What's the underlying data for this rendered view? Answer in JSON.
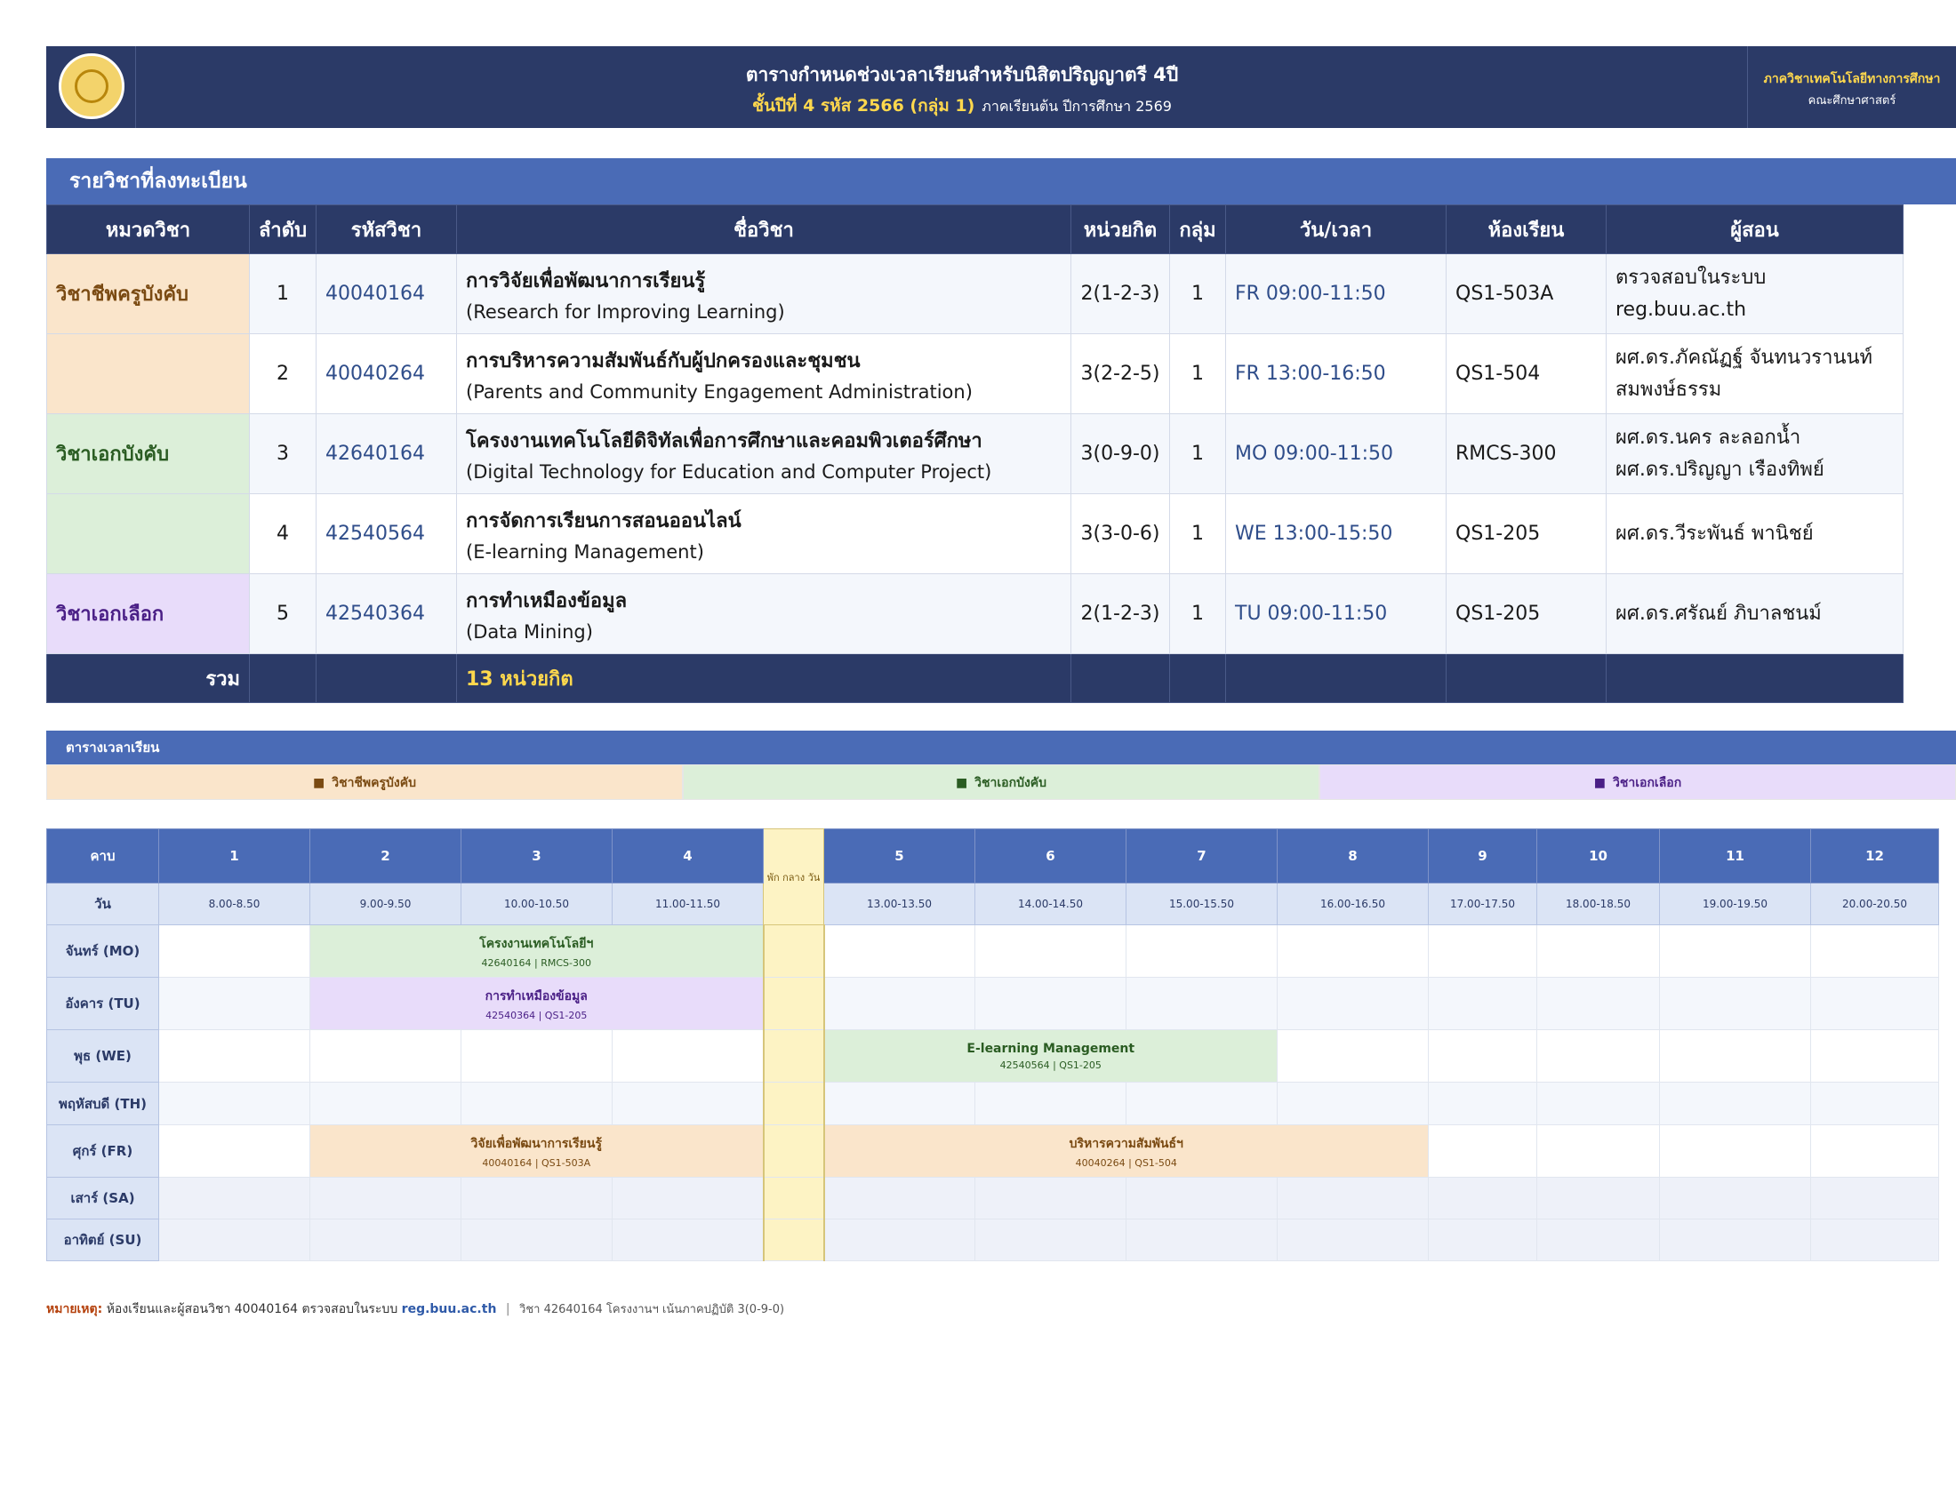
{
  "header": {
    "title": "ตารางกำหนดช่วงเวลาเรียนสำหรับนิสิตปริญญาตรี 4ปี",
    "subtitle": "ชั้นปีที่ 4  รหัส 2566  (กลุ่ม 1)",
    "term": "ภาคเรียนต้น ปีการศึกษา 2569",
    "department": "ภาควิชาเทคโนโลยีทางการศึกษา",
    "faculty": "คณะศึกษาศาสตร์"
  },
  "courses": {
    "section_title": "รายวิชาที่ลงทะเบียน",
    "columns": [
      "หมวดวิชา",
      "ลำดับ",
      "รหัสวิชา",
      "ชื่อวิชา",
      "หน่วยกิต",
      "กลุ่ม",
      "วัน/เวลา",
      "ห้องเรียน",
      "ผู้สอน"
    ],
    "rows": [
      {
        "category": "วิชาชีพครูบังคับ",
        "no": "1",
        "code": "40040164",
        "name_th": "การวิจัยเพื่อพัฒนาการเรียนรู้",
        "name_en": "(Research for Improving Learning)",
        "credits": "2(1-2-3)",
        "group": "1",
        "time": "FR 09:00-11:50",
        "room": "QS1-503A",
        "lecturer1": "ตรวจสอบในระบบ reg.buu.ac.th",
        "lecturer2": ""
      },
      {
        "category": "",
        "no": "2",
        "code": "40040264",
        "name_th": "การบริหารความสัมพันธ์กับผู้ปกครองและชุมชน",
        "name_en": "(Parents and Community Engagement Administration)",
        "credits": "3(2-2-5)",
        "group": "1",
        "time": "FR 13:00-16:50",
        "room": "QS1-504",
        "lecturer1": "ผศ.ดร.ภัคณัฏฐ์ จันทนวรานนท์",
        "lecturer2": "สมพงษ์ธรรม"
      },
      {
        "category": "วิชาเอกบังคับ",
        "no": "3",
        "code": "42640164",
        "name_th": "โครงงานเทคโนโลยีดิจิทัลเพื่อการศึกษาและคอมพิวเตอร์ศึกษา",
        "name_en": "(Digital Technology for Education and Computer Project)",
        "credits": "3(0-9-0)",
        "group": "1",
        "time": "MO 09:00-11:50",
        "room": "RMCS-300",
        "lecturer1": "ผศ.ดร.นคร ละลอกน้ำ",
        "lecturer2": "ผศ.ดร.ปริญญา เรืองทิพย์"
      },
      {
        "category": "",
        "no": "4",
        "code": "42540564",
        "name_th": "การจัดการเรียนการสอนออนไลน์",
        "name_en": "(E-learning Management)",
        "credits": "3(3-0-6)",
        "group": "1",
        "time": "WE 13:00-15:50",
        "room": "QS1-205",
        "lecturer1": "ผศ.ดร.วีระพันธ์ พานิชย์",
        "lecturer2": ""
      },
      {
        "category": "วิชาเอกเลือก",
        "no": "5",
        "code": "42540364",
        "name_th": "การทำเหมืองข้อมูล",
        "name_en": "(Data Mining)",
        "credits": "2(1-2-3)",
        "group": "1",
        "time": "TU 09:00-11:50",
        "room": "QS1-205",
        "lecturer1": "ผศ.ดร.ศรัณย์ ภิบาลชนม์",
        "lecturer2": ""
      }
    ],
    "total_label": "รวม",
    "total_value": "13  หน่วยกิต"
  },
  "timetable": {
    "section_title": "ตารางเวลาเรียน",
    "legend": {
      "prof": "วิชาชีพครูบังคับ",
      "major": "วิชาเอกบังคับ",
      "elect": "วิชาเอกเลือก"
    },
    "period_label": "คาบ",
    "day_label": "วัน",
    "break_label": "พัก กลาง วัน",
    "periods": [
      "1",
      "2",
      "3",
      "4",
      "5",
      "6",
      "7",
      "8",
      "9",
      "10",
      "11",
      "12"
    ],
    "times": [
      "8.00-8.50",
      "9.00-9.50",
      "10.00-10.50",
      "11.00-11.50",
      "13.00-13.50",
      "14.00-14.50",
      "15.00-15.50",
      "16.00-16.50",
      "17.00-17.50",
      "18.00-18.50",
      "19.00-19.50",
      "20.00-20.50"
    ],
    "days": {
      "mo": "จันทร์ (MO)",
      "tu": "อังคาร (TU)",
      "we": "พุธ (WE)",
      "th": "พฤหัสบดี (TH)",
      "fr": "ศุกร์ (FR)",
      "sa": "เสาร์ (SA)",
      "su": "อาทิตย์ (SU)"
    },
    "blocks": {
      "mo": {
        "title": "โครงงานเทคโนโลยีฯ",
        "sub": "42640164 | RMCS-300"
      },
      "tu": {
        "title": "การทำเหมืองข้อมูล",
        "sub": "42540364 | QS1-205"
      },
      "we": {
        "title": "E-learning Management",
        "sub": "42540564 | QS1-205"
      },
      "fr1": {
        "title": "วิจัยเพื่อพัฒนาการเรียนรู้",
        "sub": "40040164 | QS1-503A"
      },
      "fr2": {
        "title": "บริหารความสัมพันธ์ฯ",
        "sub": "40040264 | QS1-504"
      }
    }
  },
  "note": {
    "label": "หมายเหตุ:",
    "text": "ห้องเรียนและผู้สอนวิชา 40040164 ตรวจสอบในระบบ",
    "link": "reg.buu.ac.th",
    "sep": "|",
    "extra": "วิชา 42640164 โครงงานฯ เน้นภาคปฏิบัติ 3(0-9-0)"
  },
  "colors": {
    "navy": "#2b3a67",
    "blue": "#4a6bb6",
    "gold": "#ffd84d",
    "prof": "#fae5cb",
    "major": "#dcefd9",
    "elect": "#e8dcfa"
  }
}
